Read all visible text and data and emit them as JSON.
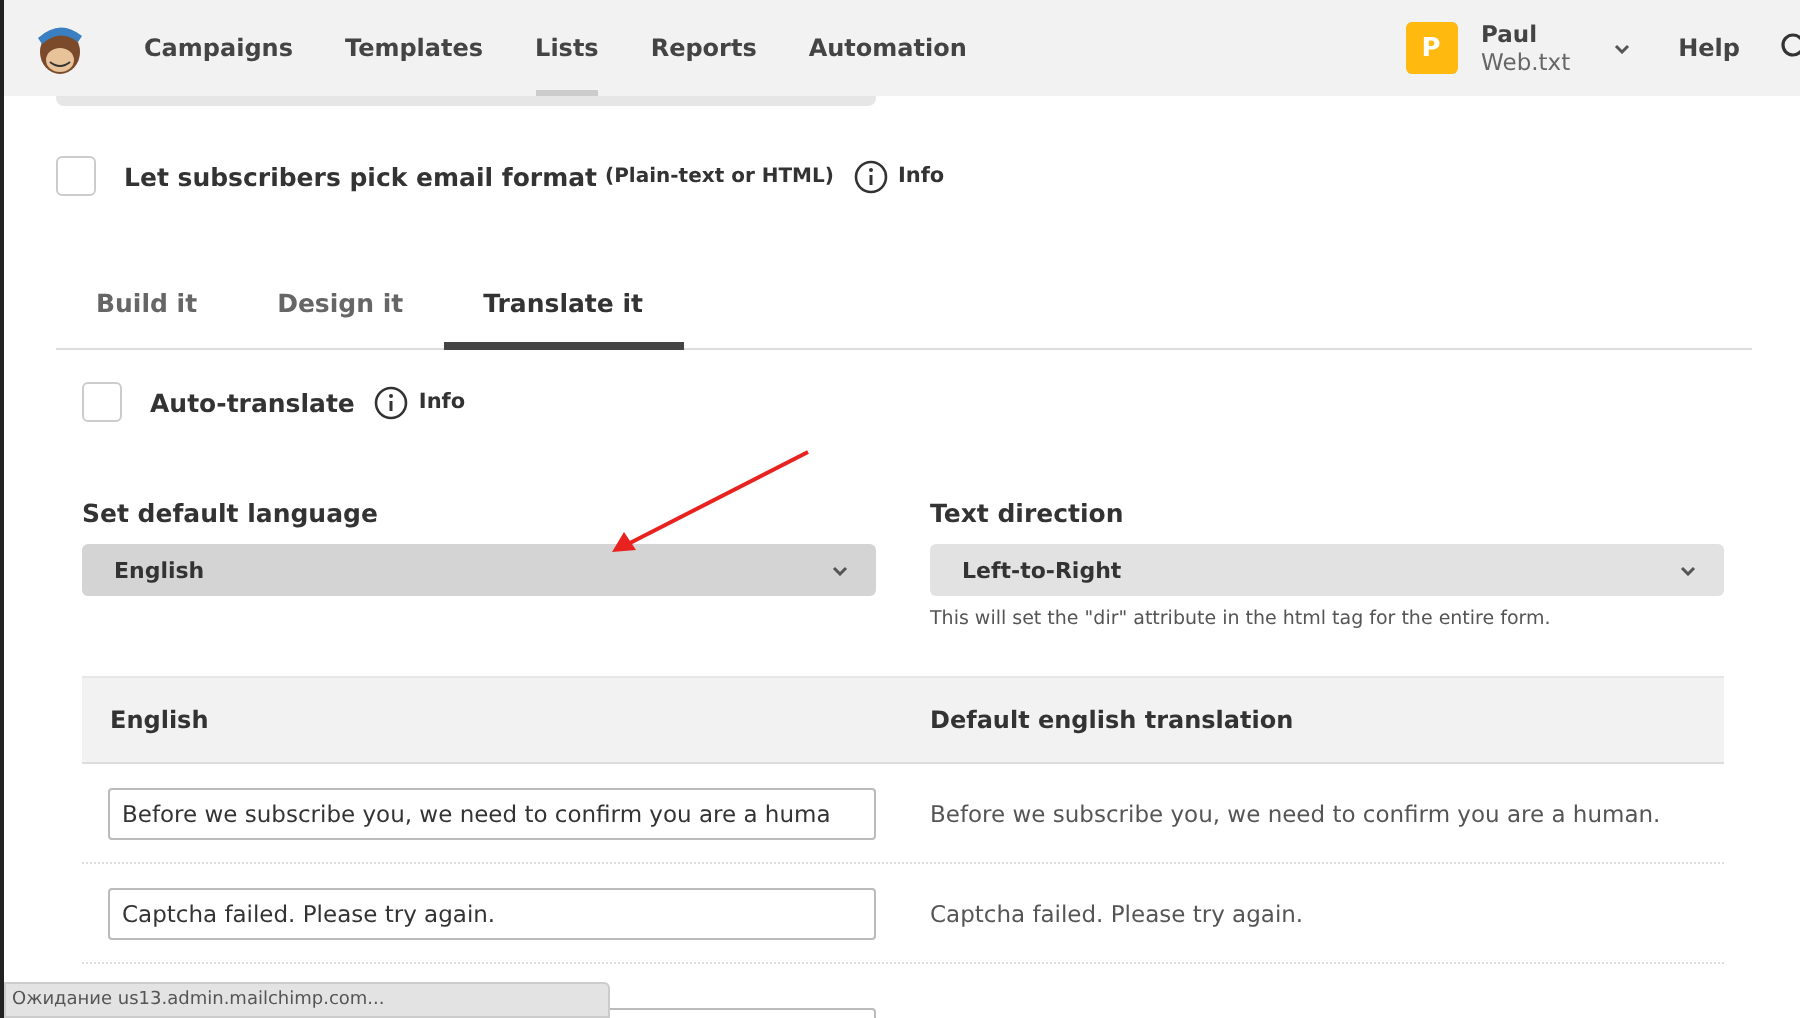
{
  "nav": {
    "items": [
      {
        "label": "Campaigns",
        "selected": false
      },
      {
        "label": "Templates",
        "selected": false
      },
      {
        "label": "Lists",
        "selected": true
      },
      {
        "label": "Reports",
        "selected": false
      },
      {
        "label": "Automation",
        "selected": false
      }
    ],
    "account": {
      "initial": "P",
      "name": "Paul",
      "org": "Web.txt"
    },
    "help": "Help"
  },
  "email_format": {
    "label": "Let subscribers pick email format",
    "note": "(Plain-text or HTML)",
    "checked": false,
    "info": "Info"
  },
  "tabs": [
    {
      "label": "Build it",
      "selected": false
    },
    {
      "label": "Design it",
      "selected": false
    },
    {
      "label": "Translate it",
      "selected": true
    }
  ],
  "auto_translate": {
    "label": "Auto-translate",
    "checked": false,
    "info": "Info"
  },
  "default_language": {
    "label": "Set default language",
    "value": "English"
  },
  "text_direction": {
    "label": "Text direction",
    "value": "Left-to-Right",
    "help": "This will set the \"dir\" attribute in the html tag for the entire form."
  },
  "table": {
    "columns": [
      "English",
      "Default english translation"
    ],
    "rows": [
      {
        "value": "Before we subscribe you, we need to confirm you are a huma",
        "translation": "Before we subscribe you, we need to confirm you are a human."
      },
      {
        "value": "Captcha failed. Please try again.",
        "translation": "Captcha failed. Please try again."
      }
    ]
  },
  "status_bar": "Ожидание us13.admin.mailchimp.com..."
}
